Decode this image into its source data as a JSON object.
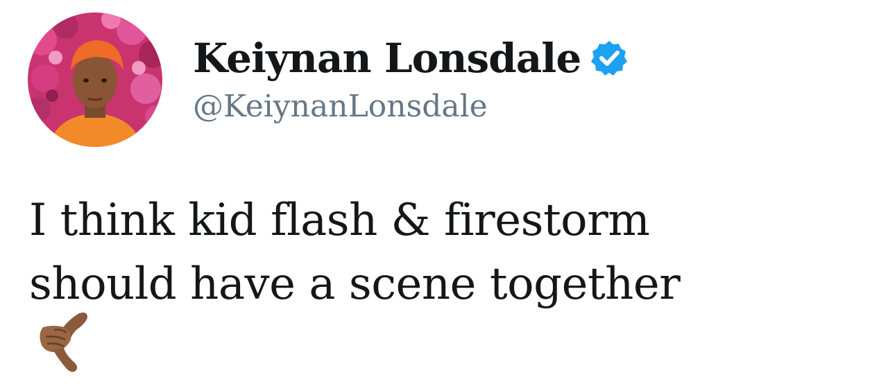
{
  "profile": {
    "display_name": "Keiynan Lonsdale",
    "handle": "@KeiynanLonsdale",
    "verified": true
  },
  "tweet": {
    "lines": [
      "I think kid flash & firestorm",
      "should have a scene together"
    ],
    "emoji": "call-me-hand-dark-skin-tone"
  },
  "colors": {
    "name": "#14171a",
    "handle": "#657786",
    "verified_badge": "#1da1f2",
    "background": "#ffffff"
  }
}
